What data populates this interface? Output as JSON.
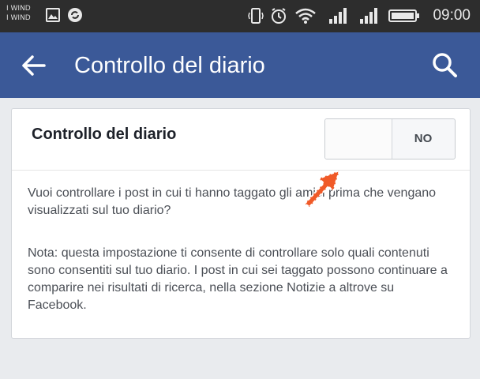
{
  "status_bar": {
    "carrier_1": "I WIND",
    "carrier_2": "I WIND",
    "time": "09:00",
    "icons": [
      "image-icon",
      "sync-icon",
      "vibrate-icon",
      "alarm-icon",
      "wifi-icon",
      "signal-icon",
      "signal-icon",
      "battery-icon"
    ]
  },
  "app_bar": {
    "title": "Controllo del diario",
    "back_icon": "arrow-left-icon",
    "search_icon": "search-icon",
    "color": "#3b5998"
  },
  "setting": {
    "label": "Controllo del diario",
    "toggle_state_label": "NO",
    "toggle_on": false
  },
  "content": {
    "paragraph_1": "Vuoi controllare i post in cui ti hanno taggato gli amici prima che vengano visualizzati sul tuo diario?",
    "paragraph_2": "Nota: questa impostazione ti consente di controllare solo quali contenuti sono consentiti sul tuo diario. I post in cui sei taggato possono continuare a comparire nei risultati di ricerca, nella sezione Notizie a altrove su Facebook."
  },
  "annotation": {
    "arrow_color": "#f05a28",
    "arrow_icon": "annotation-arrow-icon"
  }
}
